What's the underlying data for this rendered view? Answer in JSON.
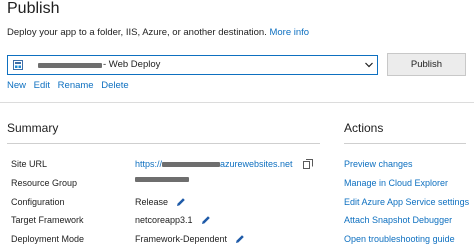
{
  "header": {
    "title": "Publish",
    "description": "Deploy your app to a folder, IIS, Azure, or another destination.",
    "more_info": "More info"
  },
  "profile": {
    "selected": "- Web Deploy",
    "publish_label": "Publish",
    "actions": [
      "New",
      "Edit",
      "Rename",
      "Delete"
    ]
  },
  "summary": {
    "heading": "Summary",
    "rows": [
      {
        "label": "Site URL",
        "value_prefix": "https://",
        "value_suffix": "azurewebsites.net"
      },
      {
        "label": "Resource Group",
        "value": ""
      },
      {
        "label": "Configuration",
        "value": "Release"
      },
      {
        "label": "Target Framework",
        "value": "netcoreapp3.1"
      },
      {
        "label": "Deployment Mode",
        "value": "Framework-Dependent"
      }
    ]
  },
  "actions_panel": {
    "heading": "Actions",
    "links": [
      "Preview changes",
      "Manage in Cloud Explorer",
      "Edit Azure App Service settings",
      "Attach Snapshot Debugger",
      "Open troubleshooting guide"
    ]
  },
  "colors": {
    "link": "#0e70c0",
    "accent_border": "#0e70c0",
    "button_bg": "#ececec"
  },
  "icons": {
    "profile": "web-deploy-icon",
    "dropdown": "chevron-down-icon",
    "edit": "pencil-icon",
    "copy": "copy-icon"
  }
}
